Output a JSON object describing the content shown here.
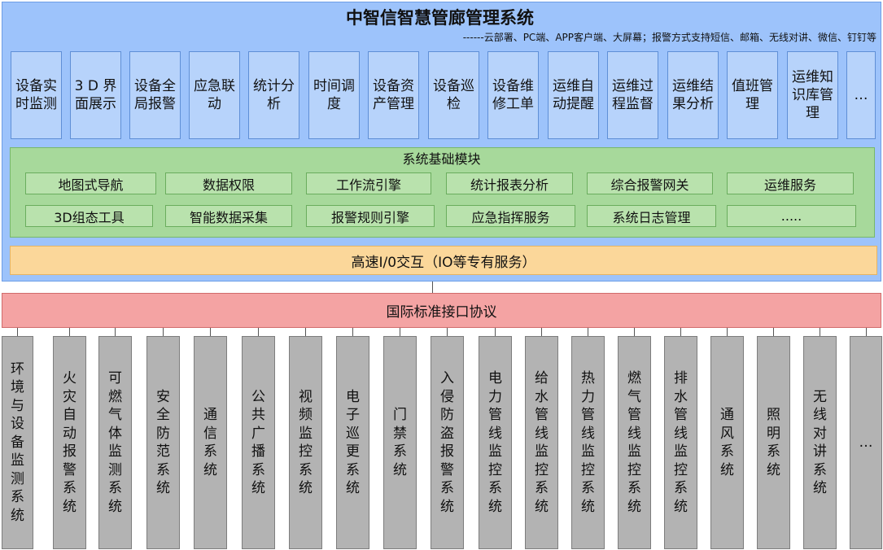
{
  "title": "中智信智慧管廊管理系统",
  "subtitle": "------云部署、PC端、APP客户端、大屏幕；报警方式支持短信、邮箱、无线对讲、微信、钉钉等",
  "applications": [
    "设备实时监测",
    "3 D 界面展示",
    "设备全局报警",
    "应急联动",
    "统计分析",
    "时间调度",
    "设备资产管理",
    "设备巡检",
    "设备维修工单",
    "运维自动提醒",
    "运维过程监督",
    "运维结果分析",
    "值班管理",
    "运维知识库管理",
    "…"
  ],
  "base_modules": {
    "title": "系统基础模块",
    "row1": [
      "地图式导航",
      "数据权限",
      "工作流引擎",
      "统计报表分析",
      "综合报警网关",
      "运维服务"
    ],
    "row2": [
      "3D组态工具",
      "智能数据采集",
      "报警规则引擎",
      "应急指挥服务",
      "系统日志管理",
      "....."
    ]
  },
  "io_bar": "高速I/0交互（IO等专有服务）",
  "protocol_bar": "国际标准接口协议",
  "subsystems": [
    "环境与设备监测系统",
    "火灾自动报警系统",
    "可燃气体监测系统",
    "安全防范系统",
    "通信系统",
    "公共广播系统",
    "视频监控系统",
    "电子巡更系统",
    "门禁系统",
    "入侵防盗报警系统",
    "电力管线监控系统",
    "给水管线监控系统",
    "热力管线监控系统",
    "燃气管线监控系统",
    "排水管线监控系统",
    "通风系统",
    "照明系统",
    "无线对讲系统",
    "…"
  ]
}
